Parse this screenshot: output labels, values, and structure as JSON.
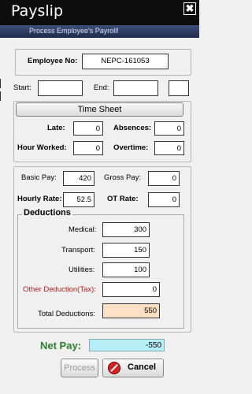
{
  "window": {
    "title": "Payslip",
    "subtitle": "Process Employee's Payroll!",
    "close_glyph": "✖"
  },
  "employee": {
    "label": "Employee No:",
    "value": "NEPC-161053",
    "start_label": "Start:",
    "start_value": "",
    "end_label": "End:",
    "end_value": "",
    "extra_value": ""
  },
  "timesheet": {
    "button_label": "Time Sheet",
    "late_label": "Late:",
    "late_value": "0",
    "absences_label": "Absences:",
    "absences_value": "0",
    "hours_label": "Hour Worked:",
    "hours_value": "0",
    "overtime_label": "Overtime:",
    "overtime_value": "0"
  },
  "pay": {
    "basic_label": "Basic Pay:",
    "basic_value": "420",
    "gross_label": "Gross Pay:",
    "gross_value": "0",
    "hourly_label": "Hourly Rate:",
    "hourly_value": "52.5",
    "ot_label": "OT Rate:",
    "ot_value": "0"
  },
  "deductions": {
    "title": "Deductions",
    "medical_label": "Medical:",
    "medical_value": "300",
    "transport_label": "Transport:",
    "transport_value": "150",
    "utilities_label": "Utilities:",
    "utilities_value": "100",
    "other_label": "Other Deduction(Tax):",
    "other_value": "0",
    "total_label": "Total Deductions:",
    "total_value": "550"
  },
  "net": {
    "label": "Net Pay:",
    "value": "-550"
  },
  "buttons": {
    "process_label": "Process",
    "cancel_label": "Cancel"
  },
  "colors": {
    "net_label": "#2d7d2d",
    "net_box": "#b5eef6",
    "total_box": "#fde0c4",
    "other_label": "#b22020"
  }
}
